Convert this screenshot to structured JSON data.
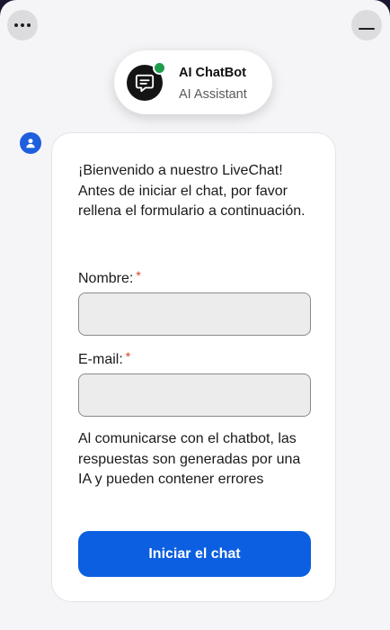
{
  "header": {
    "more_icon": "more-horizontal-icon",
    "minimize_icon": "minimize-icon"
  },
  "bot": {
    "name": "AI ChatBot",
    "subtitle": "AI Assistant",
    "avatar_icon": "chat-bubble-icon",
    "status": "online",
    "status_color": "#1e9e4b"
  },
  "message": {
    "sender_icon": "user-icon",
    "welcome_text": "¡Bienvenido a nuestro LiveChat! Antes de iniciar el chat, por favor rellena el formulario a continuación.",
    "form": {
      "name_label": "Nombre:",
      "name_value": "",
      "email_label": "E-mail:",
      "email_value": "",
      "required_mark": "*"
    },
    "disclaimer": "Al comunicarse con el chatbot, las respuestas son generadas por una IA y pueden contener errores",
    "start_button": "Iniciar el chat"
  },
  "colors": {
    "accent": "#0b5fe0",
    "required": "#e03a1e",
    "background": "#f5f5f7"
  }
}
